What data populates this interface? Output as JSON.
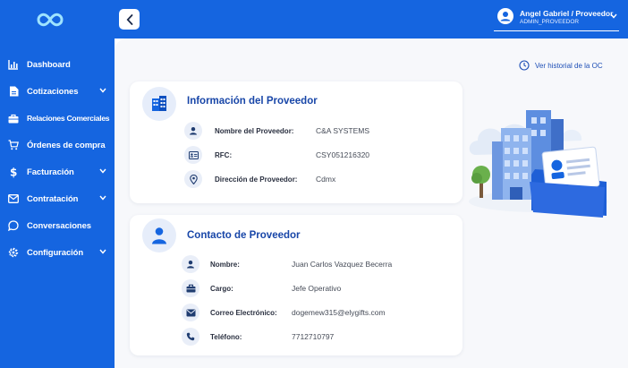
{
  "sidebar": {
    "items": [
      {
        "label": "Dashboard",
        "icon": "bar-chart-icon",
        "chevron": false
      },
      {
        "label": "Cotizaciones",
        "icon": "document-icon",
        "chevron": true
      },
      {
        "label": "Relaciones Comerciales",
        "icon": "briefcase-icon",
        "chevron": false
      },
      {
        "label": "Órdenes de compra",
        "icon": "cart-icon",
        "chevron": false
      },
      {
        "label": "Facturación",
        "icon": "dollar-icon",
        "chevron": true
      },
      {
        "label": "Contratación",
        "icon": "mail-icon",
        "chevron": true
      },
      {
        "label": "Conversaciones",
        "icon": "chat-icon",
        "chevron": false
      },
      {
        "label": "Configuración",
        "icon": "gear-icon",
        "chevron": true
      }
    ]
  },
  "header": {
    "user_name": "Angel Gabriel / Proveedor",
    "user_role": "ADMIN_PROVEEDOR"
  },
  "main": {
    "history_link": "Ver historial de la OC",
    "supplier_card": {
      "title": "Información del Proveedor",
      "rows": [
        {
          "label": "Nombre del Proveedor:",
          "value": "C&A SYSTEMS",
          "icon": "person-icon"
        },
        {
          "label": "RFC:",
          "value": "CSY051216320",
          "icon": "id-card-icon"
        },
        {
          "label": "Dirección de Proveedor:",
          "value": "Cdmx",
          "icon": "location-pin-icon"
        }
      ]
    },
    "contact_card": {
      "title": "Contacto de Proveedor",
      "rows": [
        {
          "label": "Nombre:",
          "value": "Juan Carlos Vazquez Becerra",
          "icon": "person-icon"
        },
        {
          "label": "Cargo:",
          "value": "Jefe Operativo",
          "icon": "briefcase-icon"
        },
        {
          "label": "Correo Electrónico:",
          "value": "dogemew315@elygifts.com",
          "icon": "mail-icon"
        },
        {
          "label": "Teléfono:",
          "value": "7712710797",
          "icon": "phone-icon"
        }
      ]
    }
  },
  "colors": {
    "brand": "#1565e0",
    "title": "#1846a8",
    "background": "#f7f8fb"
  }
}
